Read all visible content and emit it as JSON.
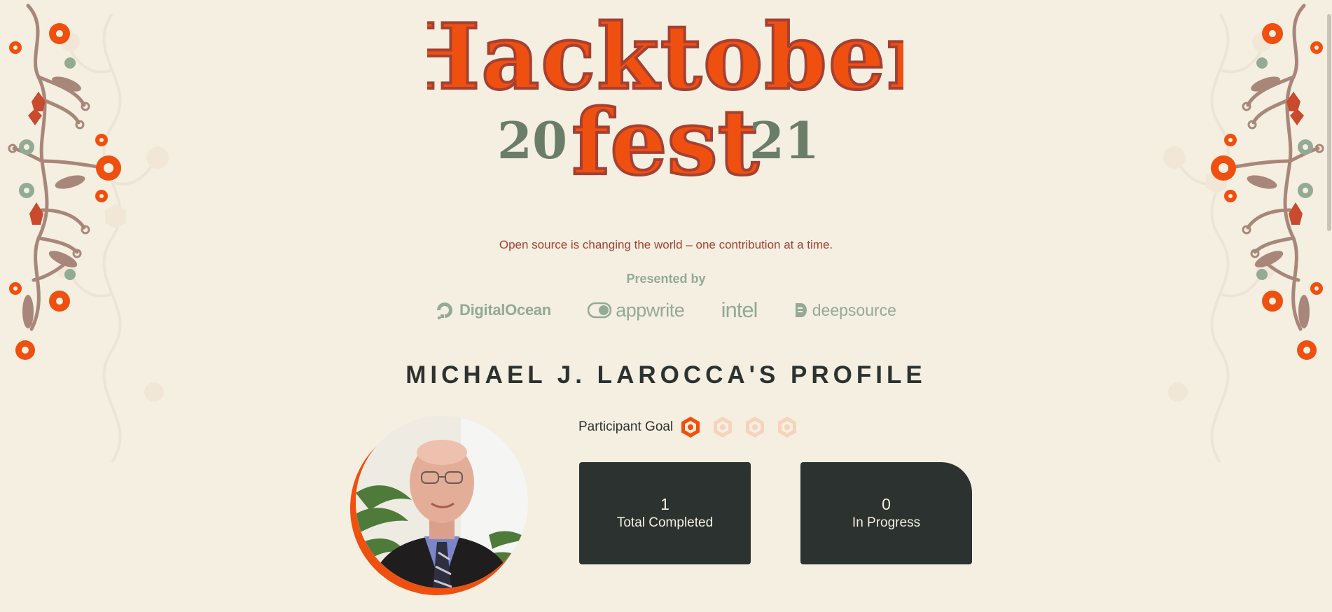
{
  "logo": {
    "word_top": "Hacktober",
    "word_bottom": "fest",
    "year_left": "20",
    "year_right": "21"
  },
  "tagline": "Open source is changing the world – one contribution at a time.",
  "presented_by": "Presented by",
  "sponsors": [
    {
      "name": "DigitalOcean",
      "icon": "digitalocean-icon"
    },
    {
      "name": "appwrite",
      "icon": "appwrite-icon"
    },
    {
      "name": "intel",
      "icon": ""
    },
    {
      "name": "deepsource",
      "icon": "deepsource-icon"
    }
  ],
  "profile": {
    "title": "MICHAEL J. LAROCCA'S PROFILE",
    "goal_label": "Participant Goal",
    "goal_badges_total": 4,
    "goal_badges_earned": 1
  },
  "stats": {
    "completed": {
      "value": "1",
      "label": "Total Completed"
    },
    "in_progress": {
      "value": "0",
      "label": "In Progress"
    }
  },
  "colors": {
    "background": "#f4efe1",
    "brand_orange": "#f0500f",
    "brand_red": "#a64033",
    "sage": "#93aa95",
    "dark": "#2b3230",
    "year_green": "#6a7d69"
  }
}
